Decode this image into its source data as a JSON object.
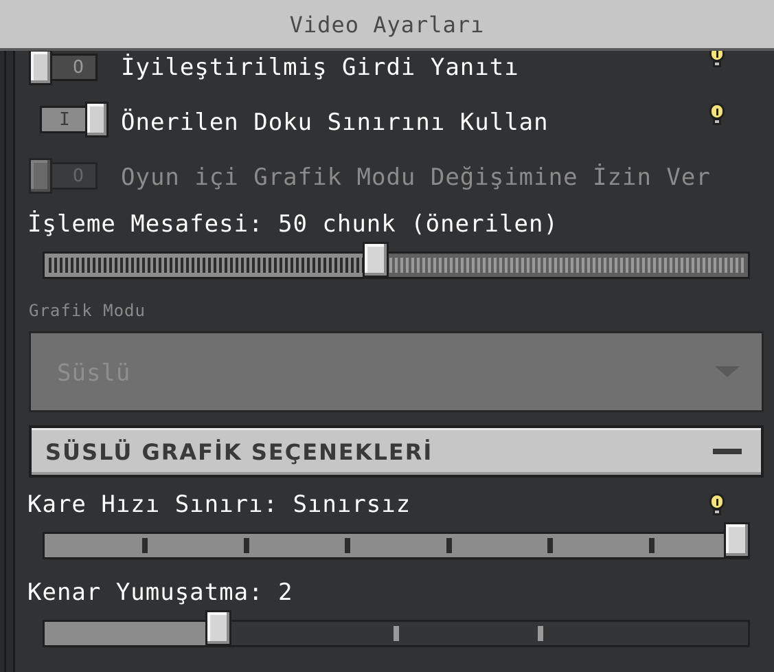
{
  "header": {
    "title": "Video Ayarları"
  },
  "toggles": [
    {
      "label": "İyileştirilmiş Girdi Yanıtı",
      "state": "off",
      "symbol": "O",
      "info": true
    },
    {
      "label": "Önerilen Doku Sınırını Kullan",
      "state": "on",
      "symbol": "I",
      "info": true
    },
    {
      "label": "Oyun içi Grafik Modu Değişimine İzin Ver",
      "state": "off",
      "symbol": "O",
      "disabled": true
    }
  ],
  "render_distance": {
    "label": "İşleme Mesafesi: 50 chunk (önerilen)",
    "value": 50
  },
  "graphics_mode": {
    "label": "Grafik Modu",
    "value": "Süslü"
  },
  "fancy_section": {
    "title": "SÜSLÜ GRAFİK SEÇENEKLERİ"
  },
  "frame_rate": {
    "label": "Kare Hızı Sınırı: Sınırsız",
    "position_fraction": 1.0
  },
  "anti_aliasing": {
    "label": "Kenar Yumuşatma: 2",
    "position_fraction": 0.25
  },
  "colors": {
    "header_bg": "#c6c6c6",
    "panel_bg": "#313233",
    "info_bulb": "#f4e37a"
  },
  "icons": [
    "info-icon",
    "chevron-down-icon",
    "minus-icon"
  ]
}
